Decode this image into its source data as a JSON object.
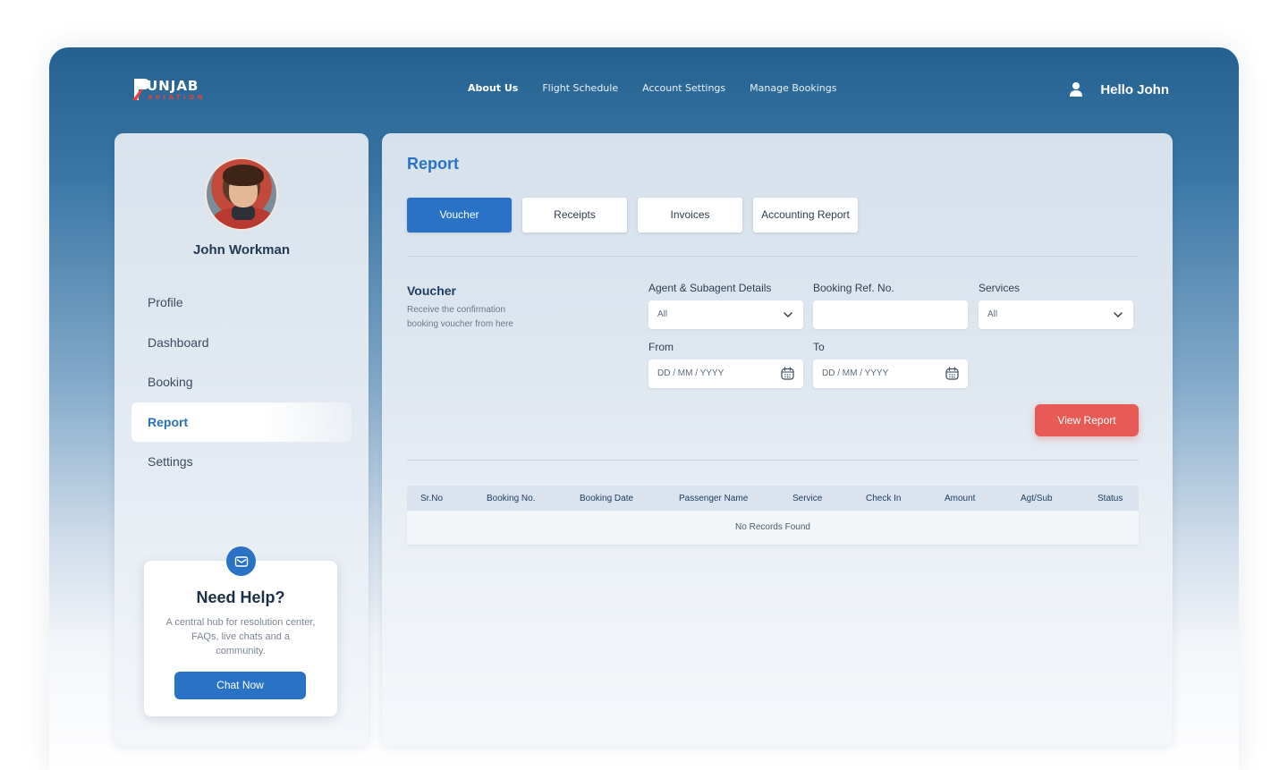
{
  "brand": {
    "name": "UNJAB",
    "tagline": "AVIATION"
  },
  "nav": {
    "items": [
      {
        "label": "About Us",
        "active": true
      },
      {
        "label": "Flight Schedule",
        "active": false
      },
      {
        "label": "Account Settings",
        "active": false
      },
      {
        "label": "Manage Bookings",
        "active": false
      }
    ]
  },
  "user": {
    "greeting": "Hello John"
  },
  "sidebar": {
    "profile_name": "John Workman",
    "items": [
      {
        "label": "Profile",
        "active": false
      },
      {
        "label": "Dashboard",
        "active": false
      },
      {
        "label": "Booking",
        "active": false
      },
      {
        "label": "Report",
        "active": true
      },
      {
        "label": "Settings",
        "active": false
      }
    ],
    "help": {
      "title": "Need Help?",
      "description": "A central hub for resolution center, FAQs, live chats and a community.",
      "button": "Chat Now"
    }
  },
  "main": {
    "title": "Report",
    "tabs": [
      {
        "label": "Voucher",
        "active": true
      },
      {
        "label": "Receipts",
        "active": false
      },
      {
        "label": "Invoices",
        "active": false
      },
      {
        "label": "Accounting Report",
        "active": false
      }
    ],
    "section": {
      "title": "Voucher",
      "description": "Receive the confirmation booking voucher from here"
    },
    "filters": {
      "agent": {
        "label": "Agent & Subagent Details",
        "value": "All"
      },
      "booking_ref": {
        "label": "Booking Ref. No.",
        "value": ""
      },
      "services": {
        "label": "Services",
        "value": "All"
      },
      "from": {
        "label": "From",
        "placeholder": "DD / MM / YYYY"
      },
      "to": {
        "label": "To",
        "placeholder": "DD / MM / YYYY"
      }
    },
    "view_button": "View Report",
    "table": {
      "columns": [
        "Sr.No",
        "Booking No.",
        "Booking Date",
        "Passenger Name",
        "Service",
        "Check In",
        "Amount",
        "Agt/Sub",
        "Status"
      ],
      "empty_text": "No Records Found"
    }
  },
  "colors": {
    "accent": "#2a72c5",
    "danger": "#e85a55",
    "header_top": "#24618f"
  }
}
